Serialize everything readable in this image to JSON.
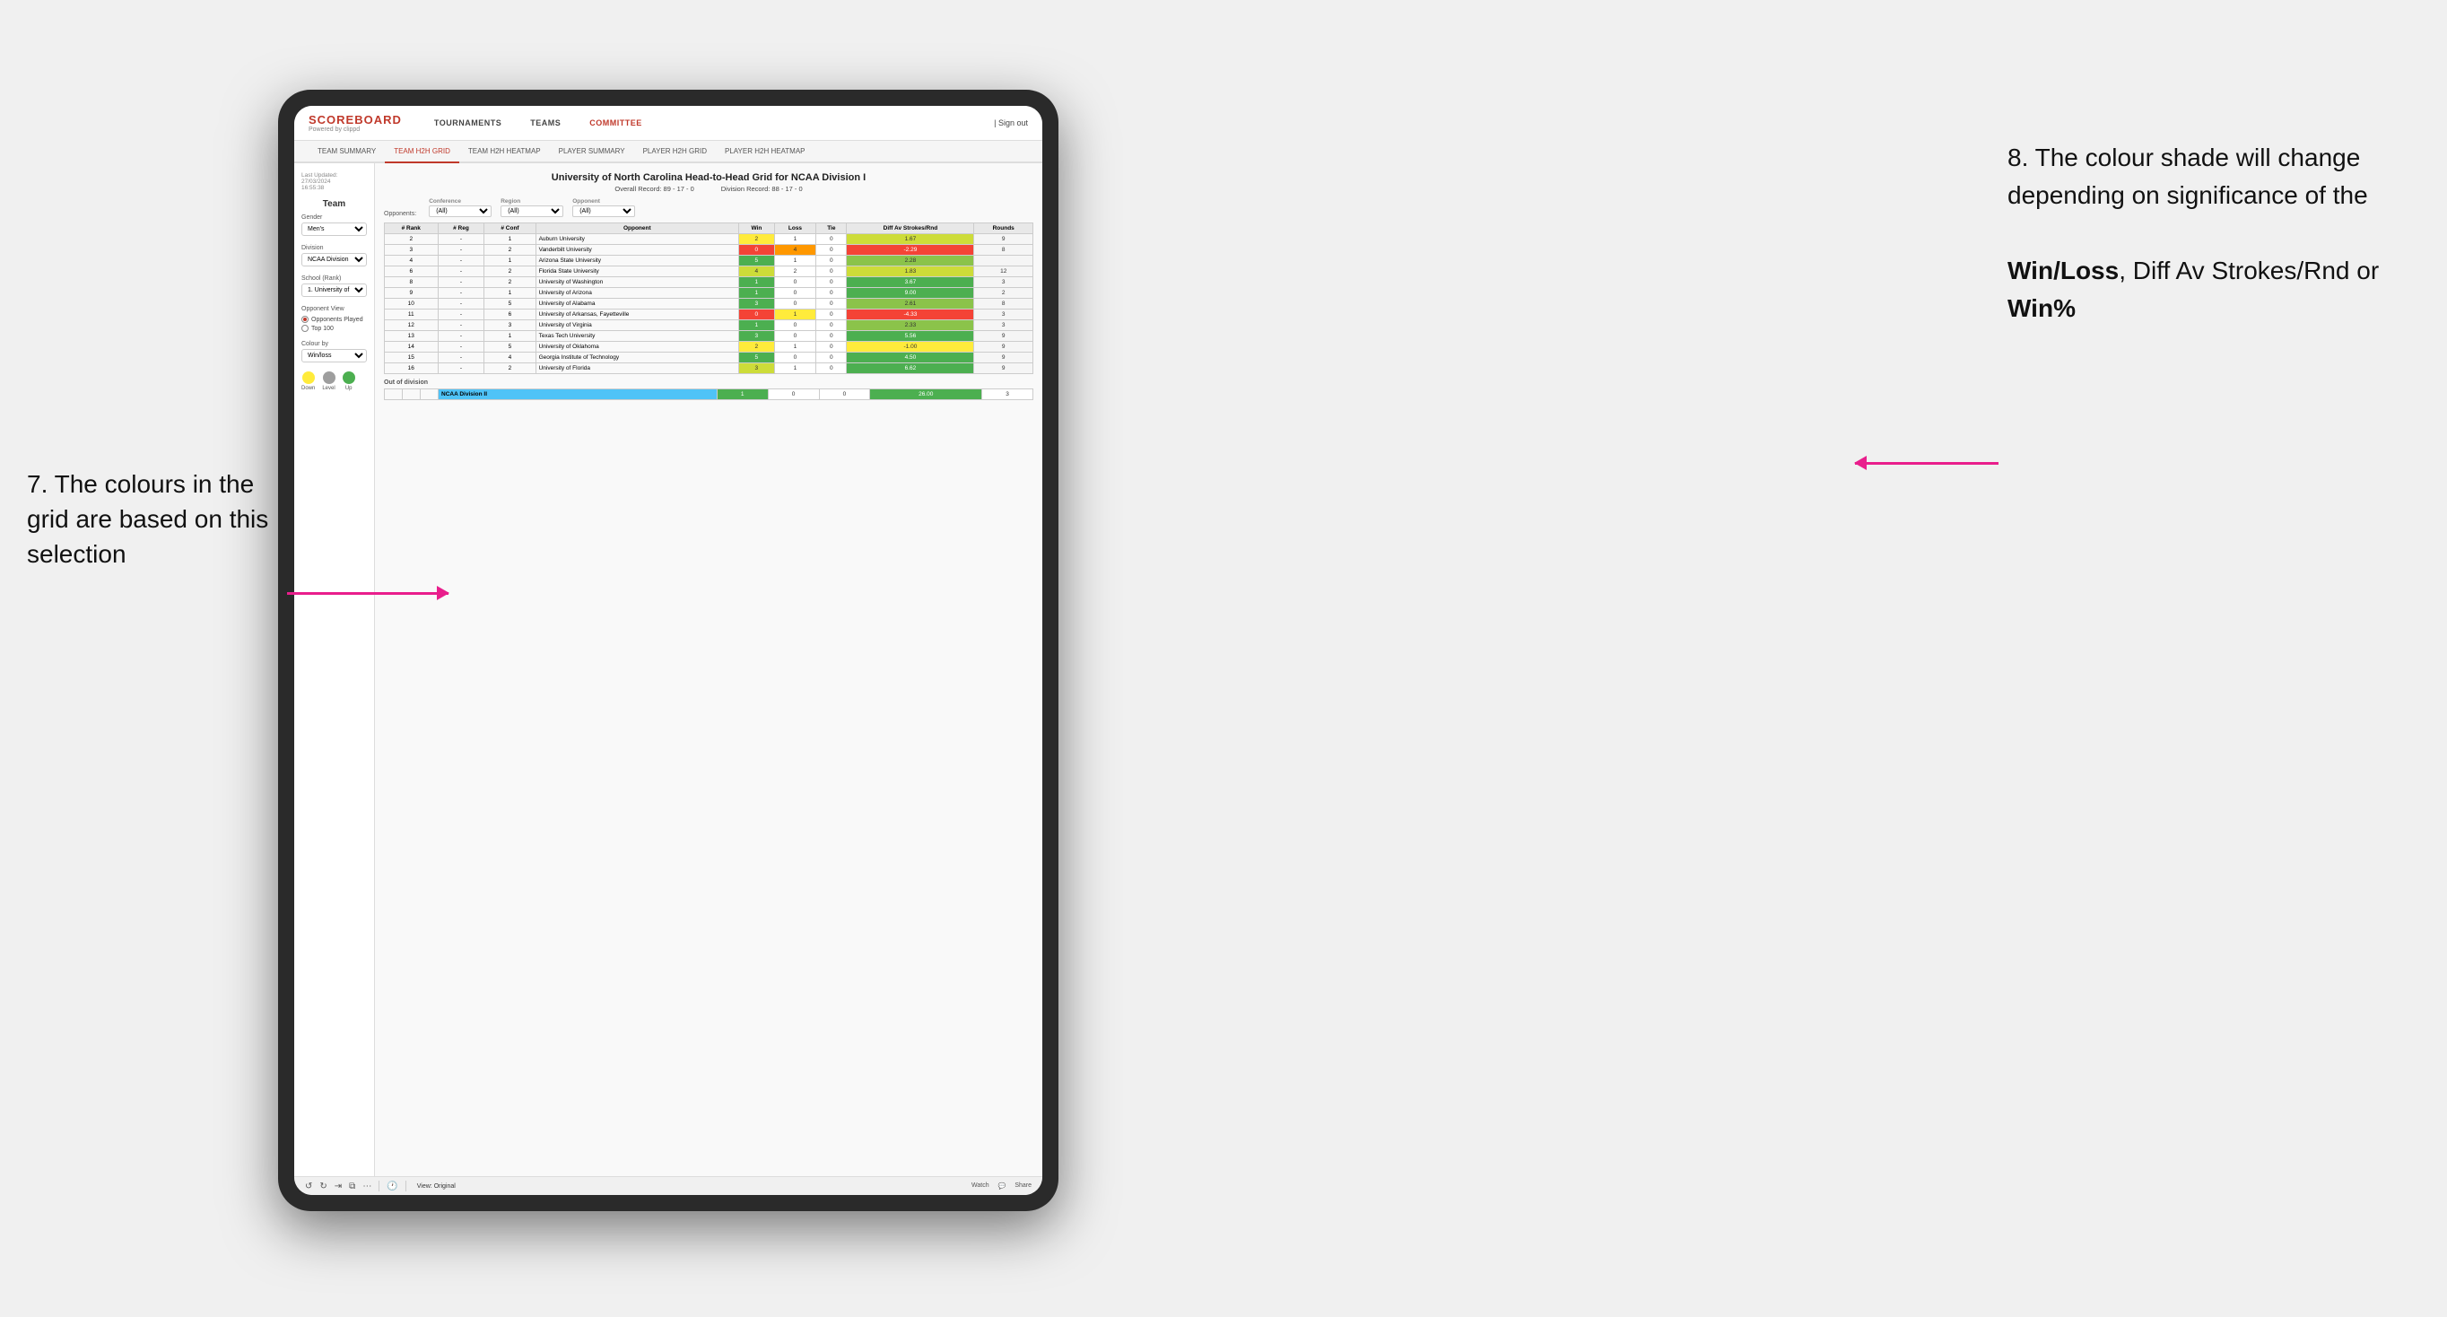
{
  "annotations": {
    "left_title": "7. The colours in the grid are based on this selection",
    "right_title": "8. The colour shade will change depending on significance of the",
    "right_bold1": "Win/Loss",
    "right_bold2": ", Diff Av Strokes/Rnd",
    "right_bold3": " or",
    "right_bold4": "Win%"
  },
  "nav": {
    "logo": "SCOREBOARD",
    "logo_sub": "Powered by clippd",
    "items": [
      "TOURNAMENTS",
      "TEAMS",
      "COMMITTEE"
    ],
    "sign_out": "Sign out"
  },
  "sub_nav": {
    "items": [
      "TEAM SUMMARY",
      "TEAM H2H GRID",
      "TEAM H2H HEATMAP",
      "PLAYER SUMMARY",
      "PLAYER H2H GRID",
      "PLAYER H2H HEATMAP"
    ],
    "active": "TEAM H2H GRID"
  },
  "sidebar": {
    "last_updated_label": "Last Updated: 27/03/2024",
    "last_updated_time": "16:55:38",
    "team_label": "Team",
    "gender_label": "Gender",
    "gender_value": "Men's",
    "division_label": "Division",
    "division_value": "NCAA Division I",
    "school_label": "School (Rank)",
    "school_value": "1. University of Nort...",
    "opponent_view_label": "Opponent View",
    "opponents_played": "Opponents Played",
    "top_100": "Top 100",
    "colour_by_label": "Colour by",
    "colour_by_value": "Win/loss",
    "legend": {
      "down": "Down",
      "level": "Level",
      "up": "Up"
    }
  },
  "grid": {
    "title": "University of North Carolina Head-to-Head Grid for NCAA Division I",
    "overall_record": "Overall Record: 89 - 17 - 0",
    "division_record": "Division Record: 88 - 17 - 0",
    "filters": {
      "conference_label": "Conference",
      "conference_value": "(All)",
      "region_label": "Region",
      "region_value": "(All)",
      "opponent_label": "Opponent",
      "opponent_value": "(All)",
      "opponents_label": "Opponents:"
    },
    "columns": [
      "# Rank",
      "# Reg",
      "# Conf",
      "Opponent",
      "Win",
      "Loss",
      "Tie",
      "Diff Av Strokes/Rnd",
      "Rounds"
    ],
    "rows": [
      {
        "rank": "2",
        "reg": "-",
        "conf": "1",
        "opponent": "Auburn University",
        "win": "2",
        "loss": "1",
        "tie": "0",
        "diff": "1.67",
        "rounds": "9",
        "win_color": "yellow",
        "loss_color": "white",
        "diff_color": "green_light"
      },
      {
        "rank": "3",
        "reg": "-",
        "conf": "2",
        "opponent": "Vanderbilt University",
        "win": "0",
        "loss": "4",
        "tie": "0",
        "diff": "-2.29",
        "rounds": "8",
        "win_color": "red",
        "loss_color": "orange",
        "diff_color": "red"
      },
      {
        "rank": "4",
        "reg": "-",
        "conf": "1",
        "opponent": "Arizona State University",
        "win": "5",
        "loss": "1",
        "tie": "0",
        "diff": "2.28",
        "rounds": "",
        "win_color": "green_dark",
        "loss_color": "white",
        "diff_color": "green_med"
      },
      {
        "rank": "6",
        "reg": "-",
        "conf": "2",
        "opponent": "Florida State University",
        "win": "4",
        "loss": "2",
        "tie": "0",
        "diff": "1.83",
        "rounds": "12",
        "win_color": "green_light",
        "loss_color": "white",
        "diff_color": "green_light"
      },
      {
        "rank": "8",
        "reg": "-",
        "conf": "2",
        "opponent": "University of Washington",
        "win": "1",
        "loss": "0",
        "tie": "0",
        "diff": "3.67",
        "rounds": "3",
        "win_color": "green_dark",
        "loss_color": "white",
        "diff_color": "green_dark"
      },
      {
        "rank": "9",
        "reg": "-",
        "conf": "1",
        "opponent": "University of Arizona",
        "win": "1",
        "loss": "0",
        "tie": "0",
        "diff": "9.00",
        "rounds": "2",
        "win_color": "green_dark",
        "loss_color": "white",
        "diff_color": "green_dark"
      },
      {
        "rank": "10",
        "reg": "-",
        "conf": "5",
        "opponent": "University of Alabama",
        "win": "3",
        "loss": "0",
        "tie": "0",
        "diff": "2.61",
        "rounds": "8",
        "win_color": "green_dark",
        "loss_color": "white",
        "diff_color": "green_med"
      },
      {
        "rank": "11",
        "reg": "-",
        "conf": "6",
        "opponent": "University of Arkansas, Fayetteville",
        "win": "0",
        "loss": "1",
        "tie": "0",
        "diff": "-4.33",
        "rounds": "3",
        "win_color": "red",
        "loss_color": "yellow",
        "diff_color": "red"
      },
      {
        "rank": "12",
        "reg": "-",
        "conf": "3",
        "opponent": "University of Virginia",
        "win": "1",
        "loss": "0",
        "tie": "0",
        "diff": "2.33",
        "rounds": "3",
        "win_color": "green_dark",
        "loss_color": "white",
        "diff_color": "green_med"
      },
      {
        "rank": "13",
        "reg": "-",
        "conf": "1",
        "opponent": "Texas Tech University",
        "win": "3",
        "loss": "0",
        "tie": "0",
        "diff": "5.56",
        "rounds": "9",
        "win_color": "green_dark",
        "loss_color": "white",
        "diff_color": "green_dark"
      },
      {
        "rank": "14",
        "reg": "-",
        "conf": "5",
        "opponent": "University of Oklahoma",
        "win": "2",
        "loss": "1",
        "tie": "0",
        "diff": "-1.00",
        "rounds": "9",
        "win_color": "yellow",
        "loss_color": "white",
        "diff_color": "yellow"
      },
      {
        "rank": "15",
        "reg": "-",
        "conf": "4",
        "opponent": "Georgia Institute of Technology",
        "win": "5",
        "loss": "0",
        "tie": "0",
        "diff": "4.50",
        "rounds": "9",
        "win_color": "green_dark",
        "loss_color": "white",
        "diff_color": "green_dark"
      },
      {
        "rank": "16",
        "reg": "-",
        "conf": "2",
        "opponent": "University of Florida",
        "win": "3",
        "loss": "1",
        "tie": "0",
        "diff": "6.62",
        "rounds": "9",
        "win_color": "green_light",
        "loss_color": "white",
        "diff_color": "green_dark"
      }
    ],
    "out_of_division": {
      "label": "Out of division",
      "division": "NCAA Division II",
      "win": "1",
      "loss": "0",
      "tie": "0",
      "diff": "26.00",
      "rounds": "3"
    }
  },
  "toolbar": {
    "view_label": "View: Original",
    "watch_label": "Watch",
    "share_label": "Share"
  }
}
